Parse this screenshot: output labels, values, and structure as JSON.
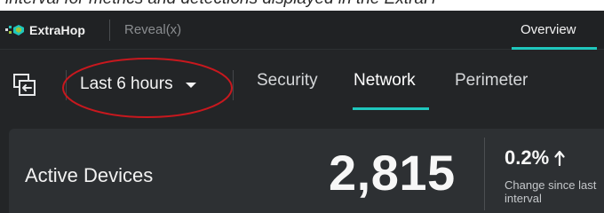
{
  "caption": "interval for metrics and detections displayed in the ExtraH",
  "header": {
    "brand": "ExtraHop",
    "product": "Reveal(x)",
    "overview_tab": "Overview"
  },
  "subnav": {
    "time_range": "Last 6 hours",
    "tabs": [
      {
        "label": "Security",
        "active": false
      },
      {
        "label": "Network",
        "active": true
      },
      {
        "label": "Perimeter",
        "active": false
      }
    ]
  },
  "metric_card": {
    "title": "Active Devices",
    "value": "2,815",
    "change": "0.2%",
    "change_direction": "up",
    "change_caption": "Change since last interval"
  },
  "colors": {
    "accent": "#1fc7bd",
    "annotation": "#c8181e",
    "background": "#232527",
    "card": "#2d3033"
  },
  "icons": [
    "extrahop-logo-icon",
    "dashboard-switch-icon",
    "chevron-down-icon",
    "arrow-up-icon"
  ]
}
